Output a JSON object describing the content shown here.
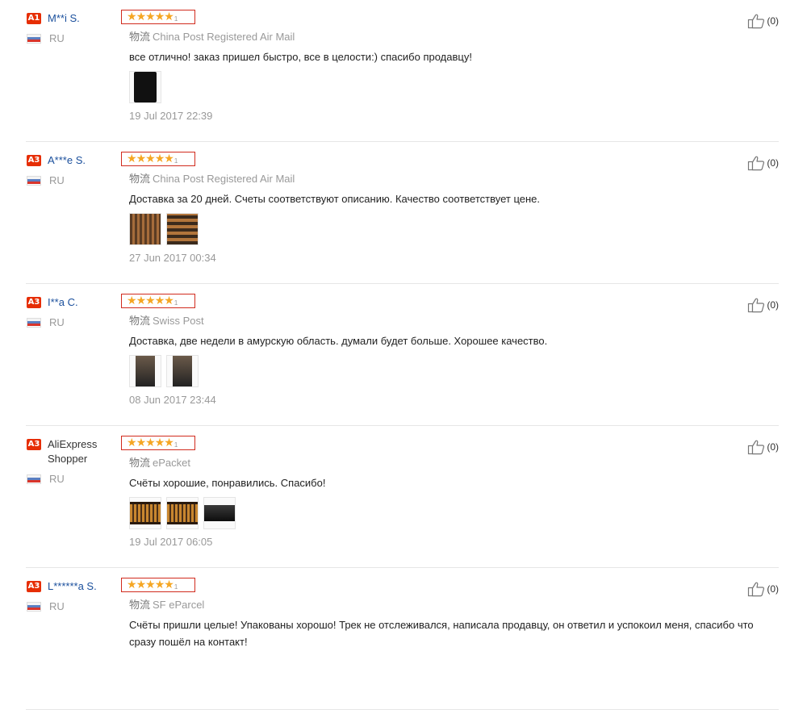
{
  "reviews": [
    {
      "level": "A1",
      "name": "M**i S.",
      "country": "RU",
      "stars": 5,
      "star_tail": "1",
      "logistics_prefix": "物流",
      "logistics": "China Post Registered Air Mail",
      "comment": "все отлично! заказ пришел быстро, все в целости:) спасибо продавцу!",
      "date": "19 Jul 2017 22:39",
      "useful_count": "(0)",
      "photos": [
        "ph-black"
      ]
    },
    {
      "level": "A3",
      "name": "A***e S.",
      "country": "RU",
      "stars": 5,
      "star_tail": "1",
      "logistics_prefix": "物流",
      "logistics": "China Post Registered Air Mail",
      "comment": "Доставка за 20 дней. Счеты соответствуют описанию. Качество соответствует цене.",
      "date": "27 Jun 2017 00:34",
      "useful_count": "(0)",
      "photos": [
        "ph-wood",
        "ph-wood2"
      ]
    },
    {
      "level": "A3",
      "name": "I**a C.",
      "country": "RU",
      "stars": 5,
      "star_tail": "1",
      "logistics_prefix": "物流",
      "logistics": "Swiss Post",
      "comment": "Доставка, две недели в амурскую область. думали будет больше. Хорошее качество.",
      "date": "08 Jun 2017 23:44",
      "useful_count": "(0)",
      "photos": [
        "ph-dark",
        "ph-dark"
      ]
    },
    {
      "level": "A3",
      "name": "AliExpress Shopper",
      "country": "RU",
      "stars": 5,
      "star_tail": "1",
      "logistics_prefix": "物流",
      "logistics": "ePacket",
      "comment": "Счёты хорошие, понравились. Спасибо!",
      "date": "19 Jul 2017 06:05",
      "useful_count": "(0)",
      "photos": [
        "ph-abacus",
        "ph-abacus",
        "ph-black2"
      ]
    },
    {
      "level": "A3",
      "name": "L******a S.",
      "country": "RU",
      "stars": 5,
      "star_tail": "1",
      "logistics_prefix": "物流",
      "logistics": "SF eParcel",
      "comment": "Счёты пришли целые! Упакованы хорошо! Трек не отслеживался, написала продавцу, он ответил и успокоил меня, спасибо что сразу пошёл на контакт!",
      "date": "",
      "useful_count": "(0)",
      "photos": []
    }
  ],
  "colors": {
    "star": "#f5a623",
    "badge": "#e62e04",
    "name_link": "#1a4f9c",
    "stars_border": "#d12b1e"
  }
}
